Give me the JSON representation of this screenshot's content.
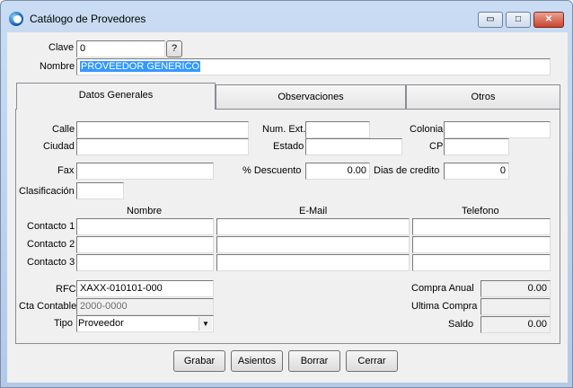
{
  "window": {
    "title": "Catálogo de Provedores",
    "min_glyph": "▭",
    "max_glyph": "□",
    "close_glyph": "✕"
  },
  "header": {
    "clave_label": "Clave",
    "clave_value": "0",
    "clave_lookup": "?",
    "nombre_label": "Nombre",
    "nombre_value": "PROVEEDOR GENERICO"
  },
  "tabs": [
    {
      "label": "Datos Generales",
      "active": true
    },
    {
      "label": "Observaciones",
      "active": false
    },
    {
      "label": "Otros",
      "active": false
    }
  ],
  "datos": {
    "calle_label": "Calle",
    "calle_value": "",
    "num_ext_label": "Num. Ext.",
    "num_ext_value": "",
    "colonia_label": "Colonia",
    "colonia_value": "",
    "ciudad_label": "Ciudad",
    "ciudad_value": "",
    "estado_label": "Estado",
    "estado_value": "",
    "cp_label": "CP",
    "cp_value": "",
    "fax_label": "Fax",
    "fax_value": "",
    "descuento_label": "% Descuento",
    "descuento_value": "0.00",
    "dias_label": "Dias de credito",
    "dias_value": "0",
    "clasificacion_label": "Clasificación",
    "clasificacion_value": ""
  },
  "contacts": {
    "col_nombre": "Nombre",
    "col_email": "E-Mail",
    "col_telefono": "Telefono",
    "rows": [
      {
        "label": "Contacto 1",
        "nombre": "",
        "email": "",
        "telefono": ""
      },
      {
        "label": "Contacto 2",
        "nombre": "",
        "email": "",
        "telefono": ""
      },
      {
        "label": "Contacto 3",
        "nombre": "",
        "email": "",
        "telefono": ""
      }
    ]
  },
  "fiscal": {
    "rfc_label": "RFC",
    "rfc_value": "XAXX-010101-000",
    "cta_label": "Cta Contable",
    "cta_value": "2000-0000",
    "tipo_label": "Tipo",
    "tipo_value": "Proveedor"
  },
  "stats": {
    "compra_anual_label": "Compra Anual",
    "compra_anual_value": "0.00",
    "ultima_compra_label": "Ultima Compra",
    "ultima_compra_value": "",
    "saldo_label": "Saldo",
    "saldo_value": "0.00"
  },
  "buttons": {
    "grabar": "Grabar",
    "asientos": "Asientos",
    "borrar": "Borrar",
    "cerrar": "Cerrar"
  }
}
